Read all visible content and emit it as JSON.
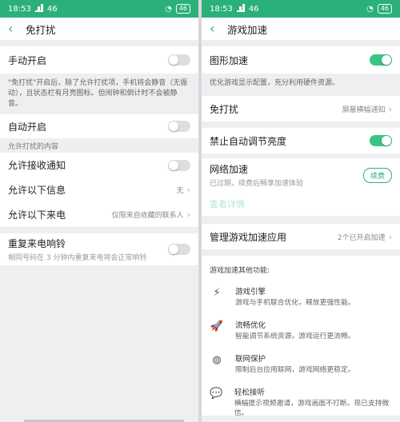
{
  "status": {
    "time": "18:53",
    "signal_text": "46",
    "battery": "46"
  },
  "left": {
    "title": "免打扰",
    "manual": {
      "label": "手动开启"
    },
    "note": "\"免打扰\"开启后，除了允许打扰项，手机将会静音（无振动），且状态栏有月亮图标。但闹钟和倒计时不会被静音。",
    "auto": {
      "label": "自动开启"
    },
    "allowed_caption": "允许打扰的内容",
    "allow_notify": {
      "label": "允许接收通知"
    },
    "allow_msg": {
      "label": "允许以下信息",
      "value": "无"
    },
    "allow_call": {
      "label": "允许以下来电",
      "value": "仅限来自收藏的联系人"
    },
    "repeat": {
      "label": "重复来电响铃",
      "sub": "相同号码在 3 分钟内重复来电将会正常响铃"
    }
  },
  "right": {
    "title": "游戏加速",
    "graphics": {
      "label": "图形加速"
    },
    "graphics_note": "优化游戏显示配置，充分利用硬件资源。",
    "dnd": {
      "label": "免打扰",
      "value": "屏蔽横幅通知"
    },
    "brightness": {
      "label": "禁止自动调节亮度"
    },
    "network": {
      "label": "网络加速",
      "sub": "已过期，续费后畅享加速体验",
      "button": "续费"
    },
    "detail_link": "查看详情",
    "manage": {
      "label": "管理游戏加速应用",
      "value": "2个已开启加速"
    },
    "features_caption": "游戏加速其他功能:",
    "features": [
      {
        "icon": "lightning-icon",
        "glyph": "⚡",
        "title": "游戏引擎",
        "desc": "游戏与手机联合优化，释放更强性能。"
      },
      {
        "icon": "rocket-icon",
        "glyph": "🚀",
        "title": "流畅优化",
        "desc": "智能调节系统资源，游戏运行更流畅。"
      },
      {
        "icon": "globe-icon",
        "glyph": "◍",
        "title": "联网保护",
        "desc": "限制后台应用联网，游戏网络更稳定。"
      },
      {
        "icon": "chat-bubble-icon",
        "glyph": "💬",
        "title": "轻松接听",
        "desc": "横幅提示视频邀请，游戏画面不打断。现已支持微信。"
      }
    ]
  }
}
